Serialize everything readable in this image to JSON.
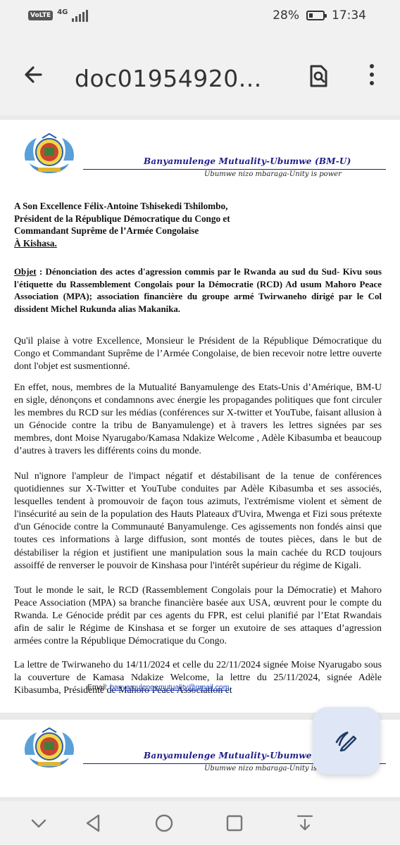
{
  "status_bar": {
    "volte": "VoLTE",
    "network": "4G",
    "battery": "28%",
    "battery_level": 0.28,
    "time": "17:34"
  },
  "app_bar": {
    "title": "doc01954920...",
    "back_icon": "arrow-back-icon",
    "search_icon": "search-in-document-icon",
    "more_icon": "more-vertical-icon"
  },
  "document": {
    "letterhead": {
      "org_name": "Banyamulenge Mutuality-Ubumwe (BM-U)",
      "motto": "Ubumwe nizo mbaraga-Unity is power"
    },
    "addressee": [
      "A Son Excellence Félix-Antoine Tshisekedi Tshilombo,",
      "Président de la République Démocratique du Congo et",
      "Commandant Suprême de l’Armée Congolaise"
    ],
    "addressee_city": "À Kishasa.",
    "objet_label": "Objet",
    "objet_text": " : Dénonciation des actes d'agression commis par le Rwanda au sud du Sud- Kivu sous l'étiquette du Rassemblement Congolais pour la Démocratie (RCD) Ad usum Mahoro Peace Association (MPA); association financière du groupe armé Twirwaneho dirigé par le Col dissident Michel Rukunda alias Makanika.",
    "paragraphs": [
      "Qu'il plaise à votre Excellence, Monsieur le Président de la République Démocratique du Congo et Commandant Suprême de l’Armée Congolaise, de bien recevoir notre lettre ouverte dont l'objet est susmentionné.",
      "En effet, nous, membres de la Mutualité Banyamulenge des Etats-Unis d’Amérique, BM-U en sigle, dénonçons et condamnons avec énergie les propagandes politiques que font circuler les membres du RCD sur les médias (conférences sur X-twitter et YouTube, faisant allusion à un Génocide contre la tribu de Banyamulenge) et à travers les lettres signées par ses membres, dont Moise Nyarugabo/Kamasa Ndakize Welcome , Adèle Kibasumba et beaucoup d’autres à travers les différents coins du monde.",
      "Nul n'ignore l'ampleur de l'impact négatif et déstabilisant de la tenue de conférences quotidiennes sur X-Twitter et YouTube conduites par Adèle Kibasumba et ses associés, lesquelles tendent à promouvoir de façon tous azimuts, l'extrémisme violent et sèment de l'insécurité au sein de la population des Hauts Plateaux d'Uvira, Mwenga et Fizi sous prétexte d'un Génocide contre la Communauté Banyamulenge. Ces agissements non fondés ainsi que toutes ces informations à large diffusion, sont montés de toutes pièces, dans le but de déstabiliser la région et justifient une manipulation sous la main cachée du RCD toujours assoiffé de renverser le pouvoir de Kinshasa pour l'intérêt supérieur du régime de Kigali.",
      "Tout le monde le sait, le RCD (Rassemblement Congolais pour la Démocratie) et Mahoro Peace Association (MPA) sa branche financière basée aux USA, œuvrent pour le compte du Rwanda. Le Génocide prédit par ces agents du FPR, est celui planifié par l’Etat Rwandais afin de salir le Régime de Kinshasa et se forger un exutoire de ses attaques d’agression armées contre la République Démocratique du Congo.",
      "La lettre de Twirwaneho du 14/11/2024 et celle du 22/11/2024 signée Moise Nyarugabo sous la couverture de Kamasa Ndakize Welcome, la lettre du 25/11/2024, signée Adèle Kibasumba, Présidente de Mahoro Peace Association et"
    ],
    "email_label": "Email: ",
    "email_address": "banyamulengemutuality@gmail.com"
  },
  "page2": {
    "org_name": "Banyamulenge Mutuality-Ubumwe (BM-",
    "motto": "Ubumwe nizo mbaraga-Unity is power"
  },
  "fab": {
    "icon": "annotate-pen-icon"
  },
  "nav_bar": {
    "items": [
      "chevron-down-icon",
      "back-triangle-icon",
      "home-circle-icon",
      "recents-square-icon",
      "download-icon"
    ]
  },
  "colors": {
    "chrome": "#f1f1f2",
    "letterhead_blue": "#1c1c8c",
    "link_blue": "#1a3fbf",
    "fab_background": "#dfe7f6"
  }
}
